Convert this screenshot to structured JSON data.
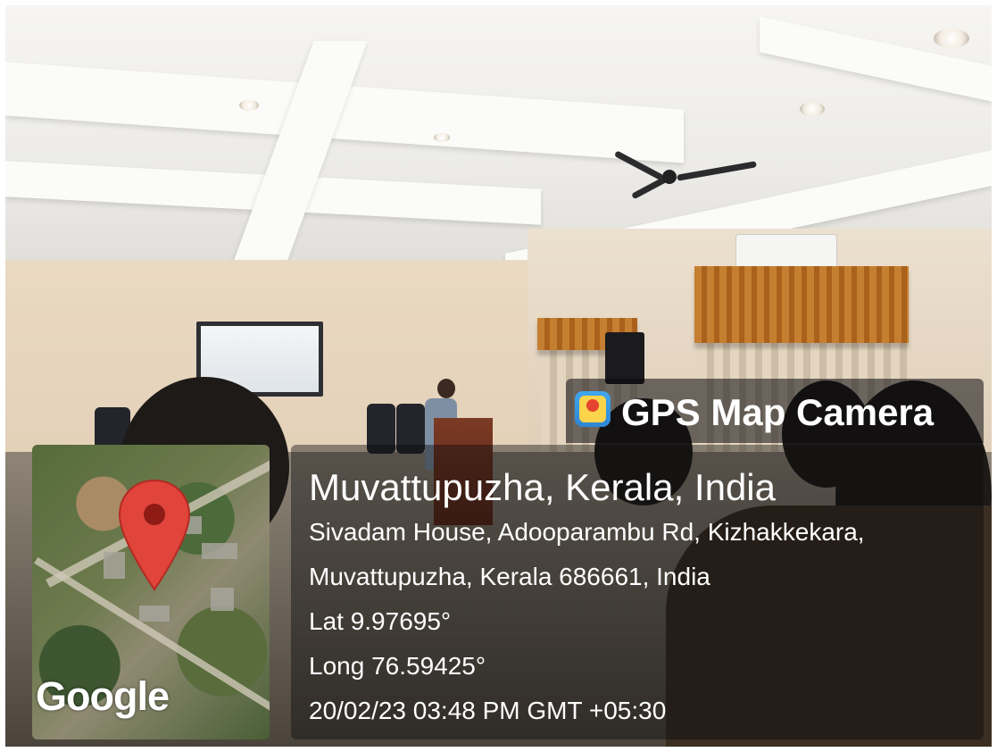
{
  "overlay": {
    "app_badge": {
      "icon": "gps-map-camera-icon",
      "title": "GPS Map Camera"
    },
    "map": {
      "pin_icon": "location-pin-icon",
      "watermark": "Google"
    },
    "location": {
      "city": "Muvattupuzha, Kerala, India",
      "address_line1": "Sivadam House, Adooparambu Rd, Kizhakkekara,",
      "address_line2": "Muvattupuzha, Kerala 686661, India",
      "latitude": "Lat 9.97695°",
      "longitude": "Long 76.59425°",
      "timestamp": "20/02/23 03:48 PM GMT +05:30"
    },
    "colors": {
      "pin": "#e0443b",
      "pin_dot": "#8e1b15",
      "panel": "#0a0a0c"
    }
  }
}
